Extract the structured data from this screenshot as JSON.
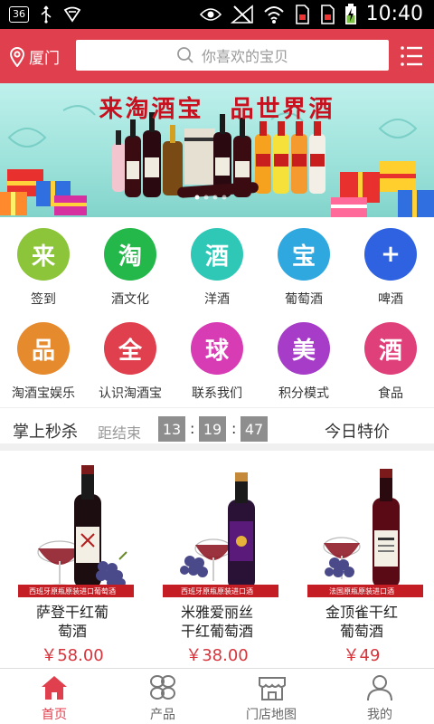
{
  "status_bar": {
    "badge": "36",
    "time": "10:40"
  },
  "header": {
    "location": "厦门",
    "search_placeholder": "你喜欢的宝贝"
  },
  "banner": {
    "title": "来淘酒宝　品世界酒",
    "colors": {
      "accent": "#c8101e"
    }
  },
  "categories": [
    {
      "char": "来",
      "label": "签到",
      "color": "#8cc43a"
    },
    {
      "char": "淘",
      "label": "酒文化",
      "color": "#24b84a"
    },
    {
      "char": "酒",
      "label": "洋酒",
      "color": "#2fc8b6"
    },
    {
      "char": "宝",
      "label": "葡萄酒",
      "color": "#2fa8e0"
    },
    {
      "char": "+",
      "label": "啤酒",
      "color": "#2f62e0"
    },
    {
      "char": "品",
      "label": "淘酒宝娱乐",
      "color": "#e68a2e"
    },
    {
      "char": "全",
      "label": "认识淘酒宝",
      "color": "#e0404e"
    },
    {
      "char": "球",
      "label": "联系我们",
      "color": "#d83cb4"
    },
    {
      "char": "美",
      "label": "积分模式",
      "color": "#a63cc8"
    },
    {
      "char": "酒",
      "label": "食品",
      "color": "#e0407a"
    }
  ],
  "flash_sale": {
    "title": "掌上秒杀",
    "countdown_label": "距结束",
    "hours": "13",
    "minutes": "19",
    "seconds": "47",
    "separator": ":",
    "today_special": "今日特价"
  },
  "products": [
    {
      "name_line1": "萨登干红葡",
      "name_line2": "萄酒",
      "price": "￥58.00",
      "ribbon": "西班牙原瓶原装进口葡萄酒",
      "label_text": "EE BODES"
    },
    {
      "name_line1": "米雅爱丽丝",
      "name_line2": "干红葡萄酒",
      "price": "￥38.00",
      "ribbon": "西班牙原瓶原装进口酒",
      "label_text": ""
    },
    {
      "name_line1": "金顶雀干红",
      "name_line2": "葡萄酒",
      "price": "￥49",
      "ribbon": "法国原瓶原装进口酒",
      "label_text": "LA LINOTTE DOREE"
    }
  ],
  "bottom_nav": [
    {
      "label": "首页",
      "icon": "home-icon",
      "active": true
    },
    {
      "label": "产品",
      "icon": "products-icon",
      "active": false
    },
    {
      "label": "门店地图",
      "icon": "store-icon",
      "active": false
    },
    {
      "label": "我的",
      "icon": "user-icon",
      "active": false
    }
  ]
}
